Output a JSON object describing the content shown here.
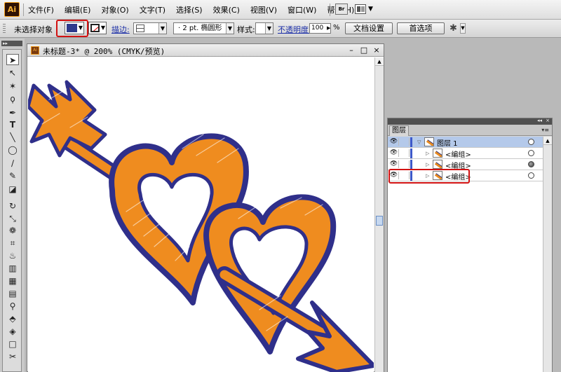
{
  "app": {
    "logo": "Ai"
  },
  "menu": [
    "文件(F)",
    "编辑(E)",
    "对象(O)",
    "文字(T)",
    "选择(S)",
    "效果(C)",
    "视图(V)",
    "窗口(W)",
    "帮助(H)"
  ],
  "menubar_right": {
    "bridge_label": "Br"
  },
  "control_bar": {
    "selection_status": "未选择对象",
    "fill_color": "#2e3a8c",
    "stroke_label": "描边:",
    "brush_label": "· 2 pt. 椭圆形",
    "style_label": "样式:",
    "opacity_label": "不透明度:",
    "opacity_value": "100",
    "opacity_unit": "%",
    "doc_setup_button": "文档设置",
    "preferences_button": "首选项"
  },
  "document": {
    "title": "未标题-3* @ 200% (CMYK/预览)",
    "minimize": "–",
    "maximize": "□",
    "close": "×"
  },
  "artwork": {
    "fill_color": "#ef8c1f",
    "stroke_color": "#2f2f8a"
  },
  "layers_panel": {
    "tab": "图层",
    "rows": [
      {
        "name": "图层 1",
        "level": 0,
        "selected": true,
        "target_filled": false
      },
      {
        "name": "<编组>",
        "level": 1,
        "selected": false,
        "target_filled": false
      },
      {
        "name": "<编组>",
        "level": 1,
        "selected": false,
        "target_filled": true
      },
      {
        "name": "<编组>",
        "level": 1,
        "selected": false,
        "target_filled": false
      }
    ]
  },
  "highlight_color": "#d21212"
}
